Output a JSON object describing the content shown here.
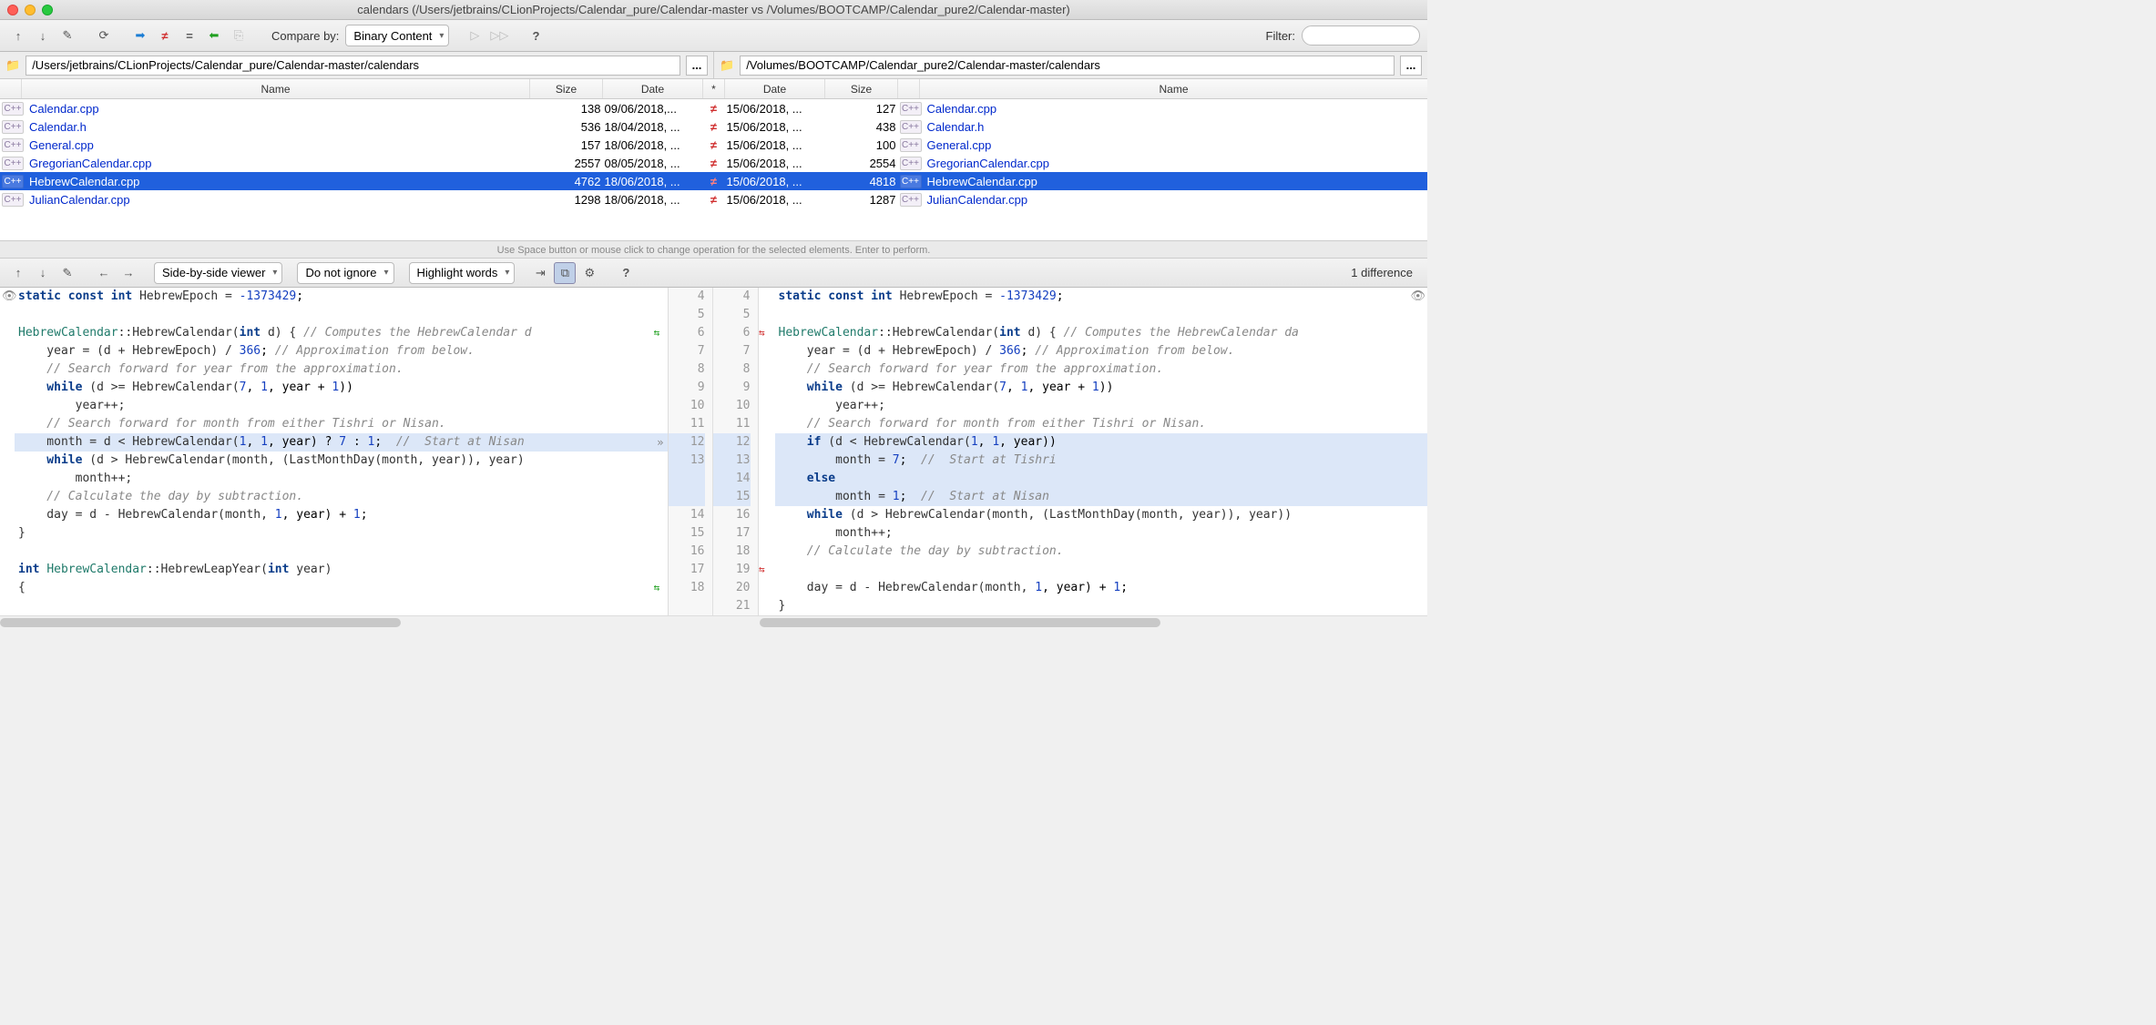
{
  "window": {
    "title": "calendars (/Users/jetbrains/CLionProjects/Calendar_pure/Calendar-master vs /Volumes/BOOTCAMP/Calendar_pure2/Calendar-master)"
  },
  "toolbar": {
    "compare_by_label": "Compare by:",
    "compare_by_value": "Binary Content",
    "filter_label": "Filter:",
    "filter_value": ""
  },
  "paths": {
    "left": "/Users/jetbrains/CLionProjects/Calendar_pure/Calendar-master/calendars",
    "right": "/Volumes/BOOTCAMP/Calendar_pure2/Calendar-master/calendars",
    "more": "..."
  },
  "columns": {
    "name": "Name",
    "size": "Size",
    "date": "Date",
    "star": "*"
  },
  "files": [
    {
      "name_l": "Calendar.cpp",
      "size_l": "138",
      "date_l": "09/06/2018,...",
      "diff": "≠",
      "date_r": "15/06/2018, ...",
      "size_r": "127",
      "name_r": "Calendar.cpp",
      "selected": false
    },
    {
      "name_l": "Calendar.h",
      "size_l": "536",
      "date_l": "18/04/2018, ...",
      "diff": "≠",
      "date_r": "15/06/2018, ...",
      "size_r": "438",
      "name_r": "Calendar.h",
      "selected": false
    },
    {
      "name_l": "General.cpp",
      "size_l": "157",
      "date_l": "18/06/2018, ...",
      "diff": "≠",
      "date_r": "15/06/2018, ...",
      "size_r": "100",
      "name_r": "General.cpp",
      "selected": false
    },
    {
      "name_l": "GregorianCalendar.cpp",
      "size_l": "2557",
      "date_l": "08/05/2018, ...",
      "diff": "≠",
      "date_r": "15/06/2018, ...",
      "size_r": "2554",
      "name_r": "GregorianCalendar.cpp",
      "selected": false
    },
    {
      "name_l": "HebrewCalendar.cpp",
      "size_l": "4762",
      "date_l": "18/06/2018, ...",
      "diff": "≠",
      "date_r": "15/06/2018, ...",
      "size_r": "4818",
      "name_r": "HebrewCalendar.cpp",
      "selected": true
    },
    {
      "name_l": "JulianCalendar.cpp",
      "size_l": "1298",
      "date_l": "18/06/2018, ...",
      "diff": "≠",
      "date_r": "15/06/2018, ...",
      "size_r": "1287",
      "name_r": "JulianCalendar.cpp",
      "selected": false
    }
  ],
  "hint": "Use Space button or mouse click to change operation for the selected elements. Enter to perform.",
  "diff_toolbar": {
    "viewer_mode": "Side-by-side viewer",
    "ignore_mode": "Do not ignore",
    "highlight_mode": "Highlight words",
    "diff_count": "1 difference"
  },
  "gutter": {
    "left": [
      "4",
      "5",
      "6",
      "7",
      "8",
      "9",
      "10",
      "11",
      "12",
      "13",
      "",
      "",
      "14",
      "15",
      "16",
      "17",
      "18"
    ],
    "right": [
      "4",
      "5",
      "6",
      "7",
      "8",
      "9",
      "10",
      "11",
      "12",
      "13",
      "14",
      "15",
      "16",
      "17",
      "18",
      "19",
      "20",
      "21"
    ]
  },
  "code": {
    "left": {
      "l0a": "static const int ",
      "l0b": "HebrewEpoch = ",
      "l0c": "-1373429",
      "l0d": ";",
      "l1": "",
      "l2a": "HebrewCalendar",
      "l2b": "::HebrewCalendar(",
      "l2c": "int ",
      "l2d": "d) { ",
      "l2e": "// Computes the HebrewCalendar d",
      "l3a": "    year = (d + HebrewEpoch) / ",
      "l3b": "366",
      "l3c": "; ",
      "l3d": "// Approximation from below.",
      "l4": "    // Search forward for year from the approximation.",
      "l5a": "    while ",
      "l5b": "(d >= HebrewCalendar(",
      "l5c": "7",
      "l5d": ", ",
      "l5e": "1",
      "l5f": ", year + ",
      "l5g": "1",
      "l5h": "))",
      "l6": "        year++;",
      "l7": "    // Search forward for month from either Tishri or Nisan.",
      "l8a": "    month = d < HebrewCalendar(",
      "l8b": "1",
      "l8c": ", ",
      "l8d": "1",
      "l8e": ", year) ? ",
      "l8f": "7",
      "l8g": " : ",
      "l8h": "1",
      "l8i": ";  ",
      "l8j": "//  Start at Nisan",
      "l9a": "    while ",
      "l9b": "(d > HebrewCalendar(month, (LastMonthDay(month, year)), year)",
      "l10": "        month++;",
      "l11": "    // Calculate the day by subtraction.",
      "l12a": "    day = d - HebrewCalendar(month, ",
      "l12b": "1",
      "l12c": ", year) + ",
      "l12d": "1",
      "l12e": ";",
      "l13": "}",
      "l14": "",
      "l15a": "int ",
      "l15b": "HebrewCalendar",
      "l15c": "::HebrewLeapYear(",
      "l15d": "int ",
      "l15e": "year)",
      "l16": "{"
    },
    "right": {
      "r0a": "static const int ",
      "r0b": "HebrewEpoch = ",
      "r0c": "-1373429",
      "r0d": ";",
      "r1": "",
      "r2a": "HebrewCalendar",
      "r2b": "::HebrewCalendar(",
      "r2c": "int ",
      "r2d": "d) { ",
      "r2e": "// Computes the HebrewCalendar da",
      "r3a": "    year = (d + HebrewEpoch) / ",
      "r3b": "366",
      "r3c": "; ",
      "r3d": "// Approximation from below.",
      "r4": "    // Search forward for year from the approximation.",
      "r5a": "    while ",
      "r5b": "(d >= HebrewCalendar(",
      "r5c": "7",
      "r5d": ", ",
      "r5e": "1",
      "r5f": ", year + ",
      "r5g": "1",
      "r5h": "))",
      "r6": "        year++;",
      "r7": "    // Search forward for month from either Tishri or Nisan.",
      "r8a": "    if ",
      "r8b": "(d < HebrewCalendar(",
      "r8c": "1",
      "r8d": ", ",
      "r8e": "1",
      "r8f": ", year))",
      "r9a": "        month = ",
      "r9b": "7",
      "r9c": ";  ",
      "r9d": "//  Start at Tishri",
      "r10a": "    else",
      "r11a": "        month = ",
      "r11b": "1",
      "r11c": ";  ",
      "r11d": "//  Start at Nisan",
      "r12a": "    while ",
      "r12b": "(d > HebrewCalendar(month, (LastMonthDay(month, year)), year))",
      "r13": "        month++;",
      "r14": "    // Calculate the day by subtraction.",
      "r15": "",
      "r16a": "    day = d - HebrewCalendar(month, ",
      "r16b": "1",
      "r16c": ", year) + ",
      "r16d": "1",
      "r16e": ";",
      "r17": "}"
    }
  },
  "chevrons": {
    "left": "»",
    "right": "«"
  },
  "gutter_arrows": {
    "swap": "⇆"
  }
}
